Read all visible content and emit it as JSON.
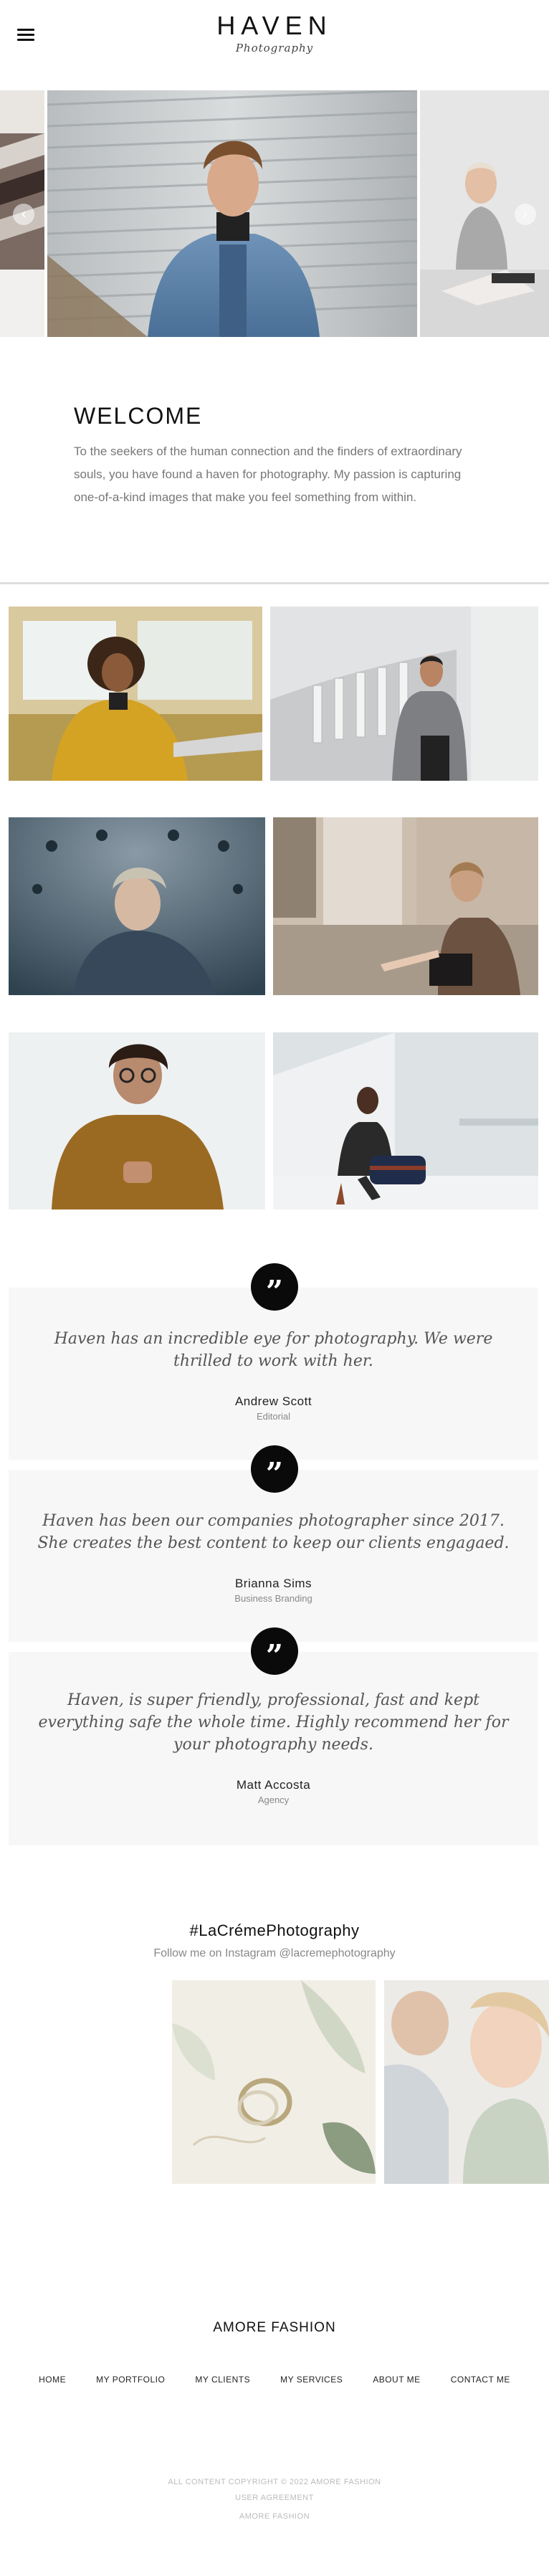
{
  "header": {
    "logo_main": "HAVEN",
    "logo_sub": "Photography"
  },
  "welcome": {
    "title": "WELCOME",
    "body": "To the seekers of the human connection and the finders of extraordinary souls, you have found a haven for photography. My passion is capturing one-of-a-kind images that make you feel something from within."
  },
  "testimonials": [
    {
      "quote": "Haven has an incredible eye for photography. We were thrilled to work with her.",
      "name": "Andrew Scott",
      "role": "Editorial"
    },
    {
      "quote": "Haven has been our companies photographer since 2017. She creates the best content to keep our clients engagaed.",
      "name": "Brianna Sims",
      "role": "Business Branding"
    },
    {
      "quote": "Haven, is super friendly, professional, fast and kept everything safe the whole time. Highly recommend her for your photography needs.",
      "name": "Matt Accosta",
      "role": "Agency"
    }
  ],
  "instagram": {
    "title": "#LaCrémePhotography",
    "subtitle": "Follow me on Instagram @lacremephotography"
  },
  "footer": {
    "brand": "AMORE FASHION",
    "nav": [
      "HOME",
      "MY PORTFOLIO",
      "MY CLIENTS",
      "MY SERVICES",
      "ABOUT ME",
      "CONTACT ME"
    ],
    "copyright": "ALL CONTENT COPYRIGHT © 2022 AMORE FASHION",
    "agreement": "USER AGREEMENT",
    "credit": "AMORE FASHION"
  },
  "icons": {
    "menu": "hamburger-menu-icon",
    "prev": "chevron-left-icon",
    "next": "chevron-right-icon",
    "quote": "quote-icon"
  },
  "colors": {
    "accent": "#0a0a0a",
    "card_bg": "#f7f7f7",
    "muted_text": "#777777"
  }
}
